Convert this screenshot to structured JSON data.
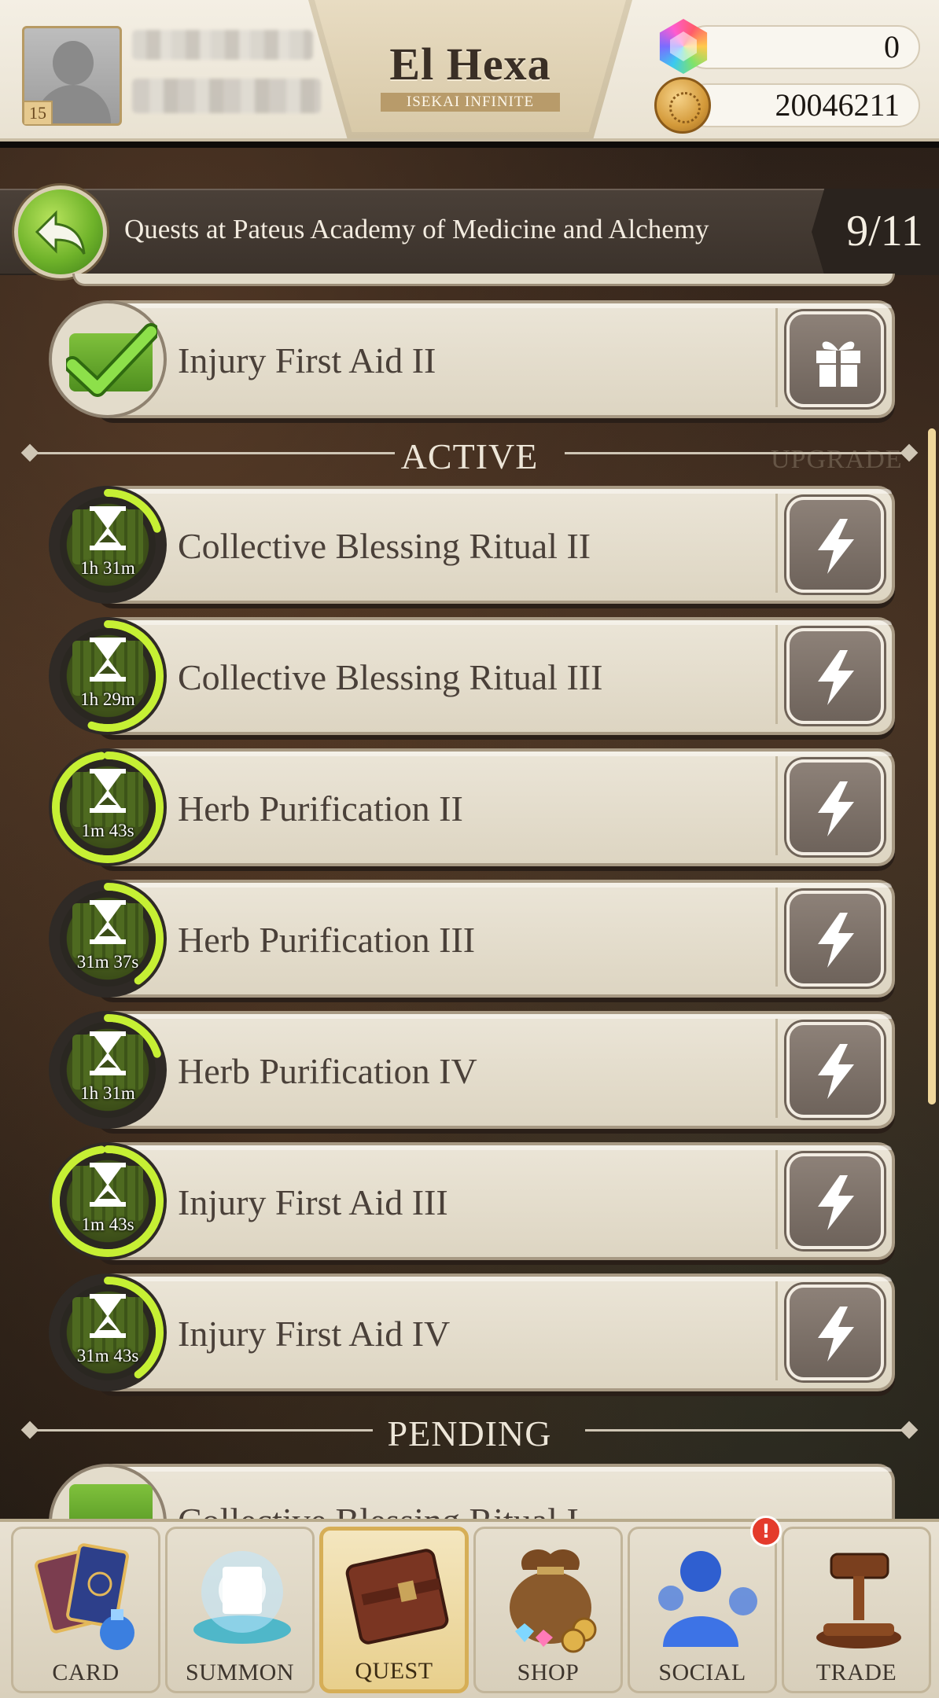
{
  "header": {
    "player_level": "15",
    "logo_title": "El Hexa",
    "logo_subtitle": "ISEKAI INFINITE",
    "gems": "0",
    "coins": "20046211"
  },
  "quest_header": {
    "title": "Quests at Pateus Academy of Medicine and Alchemy",
    "progress": "9/11"
  },
  "completed": [
    {
      "name": "Injury First Aid II",
      "action_icon": "gift-icon"
    }
  ],
  "sections": {
    "active": "ACTIVE",
    "pending": "PENDING",
    "ghost": "UPGRADE"
  },
  "active_quests": [
    {
      "name": "Collective Blessing Ritual II",
      "timer": "1h 31m",
      "progress": 0.2
    },
    {
      "name": "Collective Blessing Ritual III",
      "timer": "1h 29m",
      "progress": 0.55
    },
    {
      "name": "Herb Purification II",
      "timer": "1m 43s",
      "progress": 0.98
    },
    {
      "name": "Herb Purification III",
      "timer": "31m 37s",
      "progress": 0.4
    },
    {
      "name": "Herb Purification IV",
      "timer": "1h 31m",
      "progress": 0.2
    },
    {
      "name": "Injury First Aid III",
      "timer": "1m 43s",
      "progress": 0.98
    },
    {
      "name": "Injury First Aid IV",
      "timer": "31m 43s",
      "progress": 0.4
    }
  ],
  "pending_quests": [
    {
      "name": "Collective Blessing Ritual I"
    }
  ],
  "nav": {
    "items": [
      {
        "label": "CARD",
        "icon": "card-icon"
      },
      {
        "label": "SUMMON",
        "icon": "summon-icon"
      },
      {
        "label": "QUEST",
        "icon": "quest-book-icon",
        "active": true
      },
      {
        "label": "SHOP",
        "icon": "shop-bag-icon"
      },
      {
        "label": "SOCIAL",
        "icon": "social-icon",
        "alert": "!"
      },
      {
        "label": "TRADE",
        "icon": "gavel-icon"
      }
    ]
  },
  "colors": {
    "accent_green": "#c6f034",
    "timer_track": "#2f2a26",
    "card_bg": "#e6dfcf",
    "active_nav": "#e8cf8c"
  }
}
